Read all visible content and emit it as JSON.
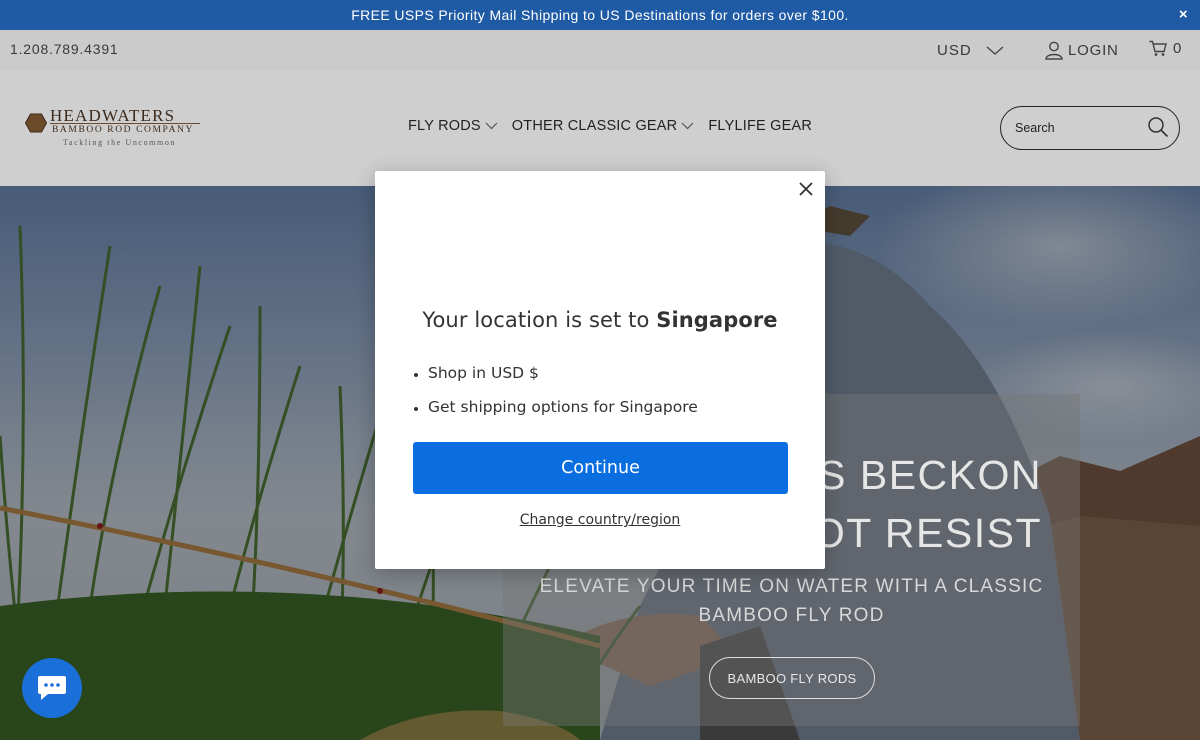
{
  "announcement": {
    "text": "FREE USPS Priority Mail Shipping to US Destinations for orders over $100.",
    "close_glyph": "×"
  },
  "utility_bar": {
    "phone": "1.208.789.4391",
    "currency": "USD",
    "login": "LOGIN",
    "cart_count": "0"
  },
  "logo": {
    "title": "HEADWATERS",
    "subtitle": "BAMBOO ROD COMPANY",
    "tagline": "Tackling the Uncommon"
  },
  "nav": {
    "items": [
      {
        "label": "FLY RODS",
        "has_dropdown": true
      },
      {
        "label": "OTHER CLASSIC GEAR",
        "has_dropdown": true
      },
      {
        "label": "FLYLIFE GEAR",
        "has_dropdown": false
      }
    ]
  },
  "search": {
    "placeholder": "Search"
  },
  "hero": {
    "heading": "S BECKON\nOT RESIST",
    "subheading": "ELEVATE YOUR TIME ON WATER WITH A CLASSIC BAMBOO FLY ROD",
    "button": "BAMBOO FLY RODS"
  },
  "modal": {
    "title_prefix": "Your location is set to ",
    "title_country": "Singapore",
    "bullets": [
      "Shop in USD $",
      "Get shipping options for Singapore"
    ],
    "continue": "Continue",
    "change_link": "Change country/region"
  },
  "colors": {
    "announcement_bg": "#1f5aa4",
    "continue_button": "#0a6ee0",
    "chat_button": "#1a6fd9"
  }
}
